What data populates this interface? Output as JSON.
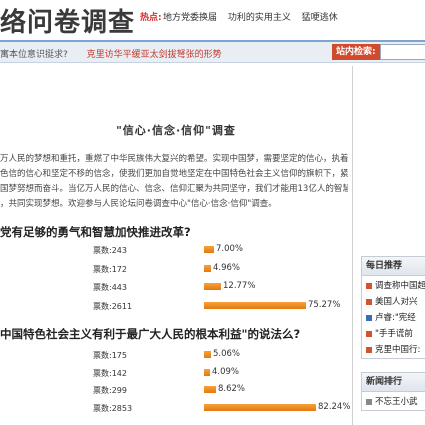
{
  "header": {
    "site_title": "络问卷调查",
    "hot_label": "热点:",
    "hot_links": [
      "地方党委换届",
      "功利的实用主义",
      "猛哽逃休"
    ]
  },
  "ticker": {
    "items": [
      "寓本位意识挺求?",
      "克里访华平缓亚太剑拔弩张的形势"
    ]
  },
  "search": {
    "label": "站内检索:",
    "value": ""
  },
  "survey": {
    "title": "\"信心·信念·信仰\"调查",
    "intro": [
      "万人民的梦想和重托，重燃了中华民族伟大复兴的希望。实现中国梦，需要坚定的信心，执着",
      "色信的信心和坚定不移的信念，使我们更加自觉地坚定在中国特色社会主义信仰的旗帜下，紧",
      "国梦努想而奋斗。当亿万人民的信心、信念、信仰汇聚为共同坚守，我们才能用13亿人的智慧和",
      "，共同实现梦想。欢迎参与人民论坛问卷调查中心\"信心·信念·信仰\"调查。"
    ]
  },
  "questions": [
    {
      "title": "党有足够的勇气和智慧加快推进改革?",
      "options": [
        {
          "votes_label": "票数:243",
          "percent": 7.0,
          "pct_label": "7.00%"
        },
        {
          "votes_label": "票数:172",
          "percent": 4.96,
          "pct_label": "4.96%"
        },
        {
          "votes_label": "票数:443",
          "percent": 12.77,
          "pct_label": "12.77%"
        },
        {
          "votes_label": "票数:2611",
          "percent": 75.27,
          "pct_label": "75.27%"
        }
      ]
    },
    {
      "title": "中国特色社会主义有利于最广大人民的根本利益\"的说法么?",
      "options": [
        {
          "votes_label": "票数:175",
          "percent": 5.06,
          "pct_label": "5.06%"
        },
        {
          "votes_label": "票数:142",
          "percent": 4.09,
          "pct_label": "4.09%"
        },
        {
          "votes_label": "票数:299",
          "percent": 8.62,
          "pct_label": "8.62%"
        },
        {
          "votes_label": "票数:2853",
          "percent": 82.24,
          "pct_label": "82.24%"
        }
      ]
    }
  ],
  "sidebar": {
    "daily": {
      "title": "每日推荐",
      "items": [
        {
          "text": "调查称中国超",
          "bullet": "red"
        },
        {
          "text": "美国人对兴",
          "bullet": "red"
        },
        {
          "text": "卢睿:\"宪经",
          "bullet": "blue"
        },
        {
          "text": "\"手手谎前",
          "bullet": "red"
        },
        {
          "text": "克里中国行:",
          "bullet": "red"
        }
      ]
    },
    "news": {
      "title": "新闻排行",
      "items": [
        {
          "text": "不忘王小武",
          "bullet": "gray"
        }
      ]
    }
  }
}
